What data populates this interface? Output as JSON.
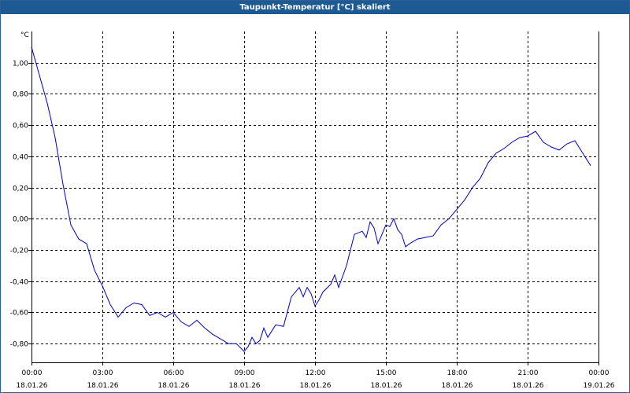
{
  "window": {
    "title": "Taupunkt-Temperatur [°C] skaliert"
  },
  "colors": {
    "title_bar": "#1d5a94",
    "series_line": "#0000c0",
    "grid": "#000000"
  },
  "chart_data": {
    "type": "line",
    "title": "Taupunkt-Temperatur [°C] skaliert",
    "ylabel": "°C",
    "xlabel": "",
    "ylim": [
      -0.92,
      1.2
    ],
    "xlim": [
      "18.01.26 00:00",
      "19.01.26 00:00"
    ],
    "grid": true,
    "legend": "none",
    "y_ticks": [
      "1,00",
      "0,80",
      "0,60",
      "0,40",
      "0,20",
      "0,00",
      "-0,20",
      "-0,40",
      "-0,60",
      "-0,80"
    ],
    "x_ticks": [
      {
        "time": "00:00",
        "date": "18.01.26"
      },
      {
        "time": "03:00",
        "date": "18.01.26"
      },
      {
        "time": "06:00",
        "date": "18.01.26"
      },
      {
        "time": "09:00",
        "date": "18.01.26"
      },
      {
        "time": "12:00",
        "date": "18.01.26"
      },
      {
        "time": "15:00",
        "date": "18.01.26"
      },
      {
        "time": "18:00",
        "date": "18.01.26"
      },
      {
        "time": "21:00",
        "date": "18.01.26"
      },
      {
        "time": "00:00",
        "date": "19.01.26"
      }
    ],
    "series": [
      {
        "x": [
          "00:00",
          "00:20",
          "00:40",
          "01:00",
          "01:20",
          "01:40",
          "02:00",
          "02:20",
          "02:40",
          "03:00",
          "03:20",
          "03:40",
          "04:00",
          "04:20",
          "04:40",
          "05:00",
          "05:20",
          "05:40",
          "06:00",
          "06:20",
          "06:40",
          "07:00",
          "07:20",
          "07:40",
          "08:00",
          "08:20",
          "08:40",
          "09:00",
          "09:10",
          "09:20",
          "09:30",
          "09:40",
          "09:50",
          "10:00",
          "10:10",
          "10:20",
          "10:40",
          "11:00",
          "11:20",
          "11:30",
          "11:40",
          "11:50",
          "12:00",
          "12:10",
          "12:20",
          "12:40",
          "12:50",
          "13:00",
          "13:20",
          "13:40",
          "14:00",
          "14:10",
          "14:20",
          "14:30",
          "14:40",
          "14:50",
          "15:00",
          "15:10",
          "15:20",
          "15:30",
          "15:40",
          "15:50",
          "16:00",
          "16:20",
          "16:40",
          "17:00",
          "17:20",
          "17:40",
          "18:00",
          "18:20",
          "18:40",
          "19:00",
          "19:20",
          "19:40",
          "20:00",
          "20:20",
          "20:40",
          "21:00",
          "21:20",
          "21:40",
          "22:00",
          "22:20",
          "22:40",
          "23:00",
          "23:20",
          "23:40"
        ],
        "values": [
          1.1,
          0.92,
          0.74,
          0.52,
          0.22,
          -0.04,
          -0.13,
          -0.16,
          -0.33,
          -0.43,
          -0.55,
          -0.63,
          -0.57,
          -0.54,
          -0.55,
          -0.62,
          -0.6,
          -0.63,
          -0.6,
          -0.66,
          -0.69,
          -0.65,
          -0.7,
          -0.74,
          -0.77,
          -0.8,
          -0.8,
          -0.85,
          -0.82,
          -0.76,
          -0.8,
          -0.78,
          -0.7,
          -0.76,
          -0.72,
          -0.68,
          -0.69,
          -0.5,
          -0.44,
          -0.5,
          -0.44,
          -0.48,
          -0.56,
          -0.52,
          -0.47,
          -0.42,
          -0.36,
          -0.44,
          -0.3,
          -0.1,
          -0.08,
          -0.12,
          -0.02,
          -0.06,
          -0.16,
          -0.1,
          -0.04,
          -0.05,
          0.0,
          -0.07,
          -0.1,
          -0.18,
          -0.16,
          -0.13,
          -0.12,
          -0.11,
          -0.04,
          0.0,
          0.06,
          0.12,
          0.2,
          0.26,
          0.36,
          0.42,
          0.45,
          0.49,
          0.52,
          0.53,
          0.56,
          0.49,
          0.46,
          0.44,
          0.48,
          0.5,
          0.42,
          0.34
        ]
      }
    ]
  }
}
